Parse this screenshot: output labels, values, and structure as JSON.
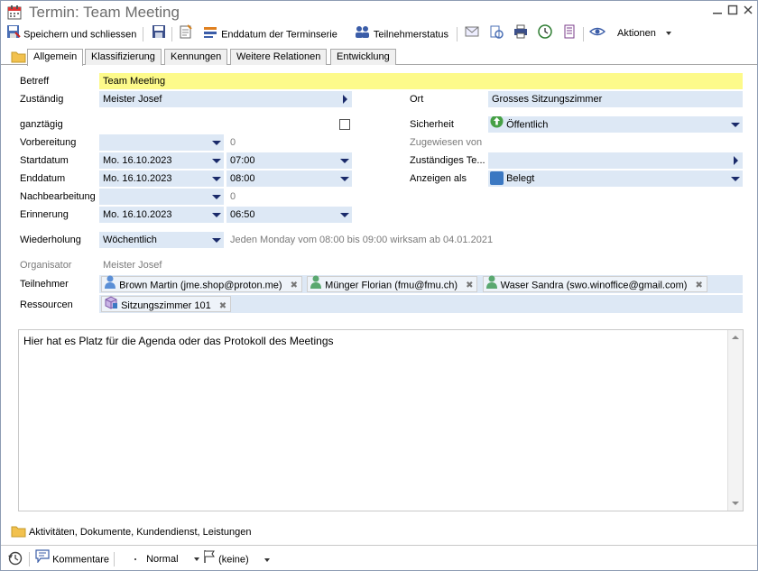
{
  "window": {
    "title": "Termin: Team Meeting"
  },
  "toolbar": {
    "save_close": "Speichern und schliessen",
    "end_series": "Enddatum der Terminserie",
    "participant_status": "Teilnehmerstatus",
    "actions": "Aktionen"
  },
  "tabs": [
    "Allgemein",
    "Klassifizierung",
    "Kennungen",
    "Weitere Relationen",
    "Entwicklung"
  ],
  "form": {
    "subject_label": "Betreff",
    "subject_value": "Team Meeting",
    "responsible_label": "Zuständig",
    "responsible_value": "Meister Josef",
    "location_label": "Ort",
    "location_value": "Grosses Sitzungszimmer",
    "allday_label": "ganztägig",
    "security_label": "Sicherheit",
    "security_value": "Öffentlich",
    "prep_label": "Vorbereitung",
    "prep_value": "0",
    "assigned_label": "Zugewiesen von",
    "start_label": "Startdatum",
    "start_date": "Mo. 16.10.2023",
    "start_time": "07:00",
    "responsible_team_label": "Zuständiges Te...",
    "end_label": "Enddatum",
    "end_date": "Mo. 16.10.2023",
    "end_time": "08:00",
    "show_as_label": "Anzeigen als",
    "show_as_value": "Belegt",
    "post_label": "Nachbearbeitung",
    "post_value": "0",
    "reminder_label": "Erinnerung",
    "reminder_date": "Mo. 16.10.2023",
    "reminder_time": "06:50",
    "repeat_label": "Wiederholung",
    "repeat_value": "Wöchentlich",
    "repeat_text": "Jeden Monday vom 08:00 bis 09:00 wirksam ab 04.01.2021",
    "organizer_label": "Organisator",
    "organizer_value": "Meister Josef",
    "participants_label": "Teilnehmer",
    "participants": [
      "Brown Martin (jme.shop@proton.me)",
      "Münger Florian (fmu@fmu.ch)",
      "Waser Sandra (swo.winoffice@gmail.com)"
    ],
    "resources_label": "Ressourcen",
    "resources": [
      "Sitzungszimmer 101"
    ]
  },
  "memo": {
    "text": "Hier hat es Platz für die Agenda oder das Protokoll des Meetings"
  },
  "footer": {
    "section": "Aktivitäten, Dokumente, Kundendienst, Leistungen",
    "comments": "Kommentare",
    "priority": "Normal",
    "flag": "(keine)"
  },
  "colors": {
    "field_bg": "#dde8f5",
    "subject_bg": "#fdfa8a",
    "security_green": "#46a046",
    "show_as_blue": "#3b78c2"
  },
  "icons": [
    "calendar-icon",
    "save-icon",
    "checklist-icon",
    "series-end-icon",
    "people-icon",
    "mail-icon",
    "attach-icon",
    "print-icon",
    "clock-icon",
    "notes-icon",
    "eye-icon",
    "folder-icon",
    "history-icon",
    "comment-icon",
    "flag-icon"
  ]
}
